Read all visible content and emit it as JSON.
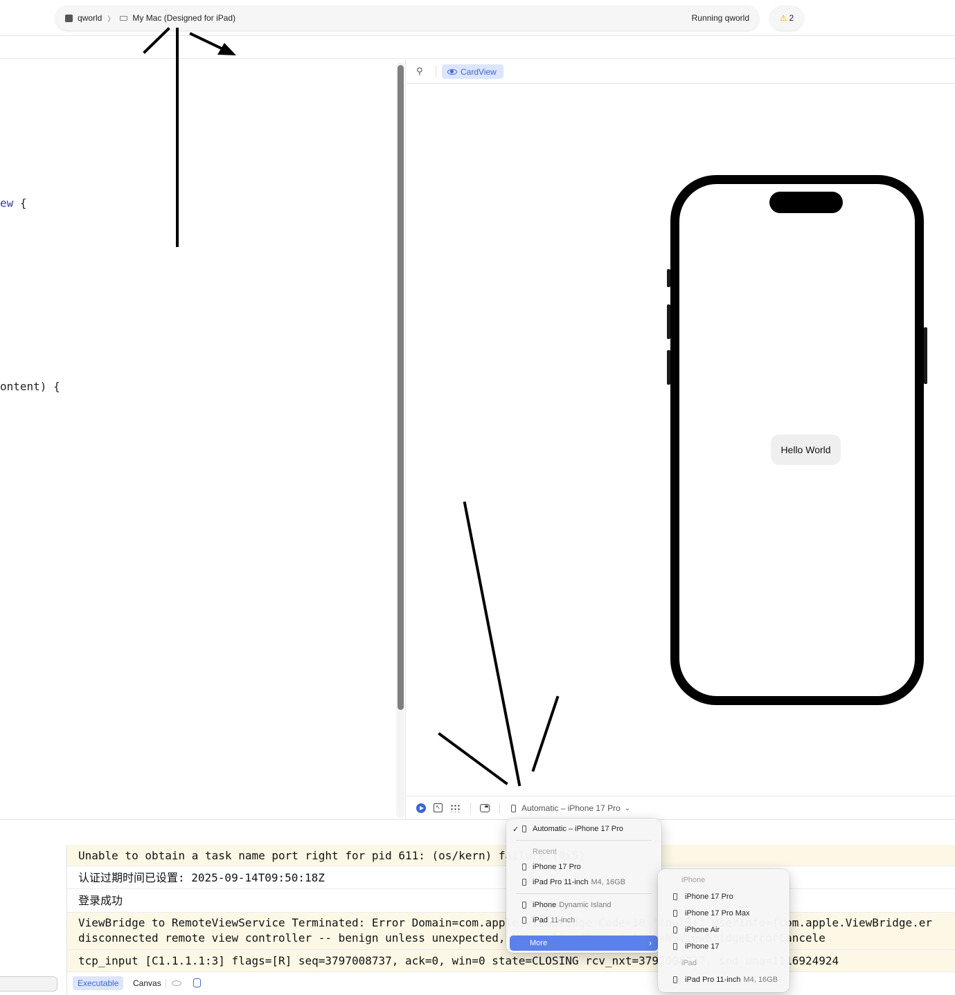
{
  "toolbar": {
    "project": "qworld",
    "breadcrumb_sep": "〉",
    "destination": "My Mac (Designed for iPad)",
    "status": "Running qworld",
    "warning_count": "2"
  },
  "editor": {
    "lines": [
      {
        "prefix": "ew",
        "rest": " {"
      },
      {
        "prefix": "",
        "rest": "ontent) {"
      }
    ]
  },
  "canvas": {
    "preview_chip": "CardView",
    "hello_text": "Hello World",
    "device_picker_label": "Automatic – iPhone 17 Pro"
  },
  "console": {
    "logs": [
      "Unable to obtain a task name port right for pid 611: (os/kern) failure (0x5)",
      "认证过期时间已设置: 2025-09-14T09:50:18Z",
      "登录成功",
      "ViewBridge to RemoteViewService Terminated: Error Domain=com.apple.ViewBridge Code=18 \"(null)\" UserInfo={com.apple.ViewBridge.er\ndisconnected remote view controller -- benign unless unexpected, NSLocalizedDescription=NSViewBridgeErrorCancele",
      "tcp_input [C1.1.1.1:3] flags=[R] seq=3797008737, ack=0, win=0 state=CLOSING rcv_nxt=3797008737, snd_una=1116924924"
    ],
    "footer": {
      "executable": "Executable",
      "canvas": "Canvas"
    }
  },
  "device_menu": {
    "selected": "Automatic – iPhone 17 Pro",
    "recent_header": "Recent",
    "recent": [
      {
        "name": "iPhone 17 Pro",
        "detail": ""
      },
      {
        "name": "iPad Pro 11-inch",
        "detail": "M4, 16GB"
      }
    ],
    "generic": [
      {
        "name": "iPhone",
        "detail": "Dynamic Island"
      },
      {
        "name": "iPad",
        "detail": "11-inch"
      }
    ],
    "more": "More"
  },
  "more_menu": {
    "iphone_header": "iPhone",
    "iphones": [
      "iPhone 17 Pro",
      "iPhone 17 Pro Max",
      "iPhone Air",
      "iPhone 17"
    ],
    "ipad_header": "iPad",
    "ipads": [
      {
        "name": "iPad Pro 11-inch",
        "detail": "M4, 16GB"
      }
    ]
  }
}
